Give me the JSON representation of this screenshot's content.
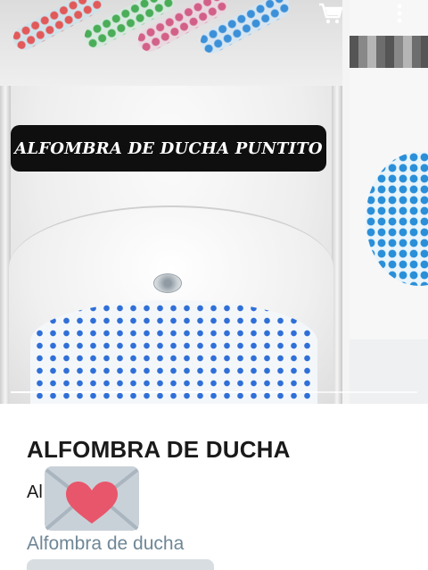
{
  "gallery": {
    "slide_title": "ALFOMBRA DE DUCHA PUNTITO",
    "icons": {
      "cart": "shopping-cart-icon",
      "more": "more-vertical-icon"
    },
    "progress": 0.5
  },
  "product": {
    "title": "ALFOMBRA DE DUCHA",
    "subtitle_visible": "Al",
    "envelope_icon": "envelope-heart-icon",
    "link_label": "Alfombra de ducha"
  },
  "colors": {
    "title_pill_bg": "#0f0f0f",
    "dot_blue": "#2f6fd8",
    "link_gray_blue": "#6f8796",
    "heart_red": "#e8566b",
    "envelope_gray": "#c9d1d8"
  }
}
